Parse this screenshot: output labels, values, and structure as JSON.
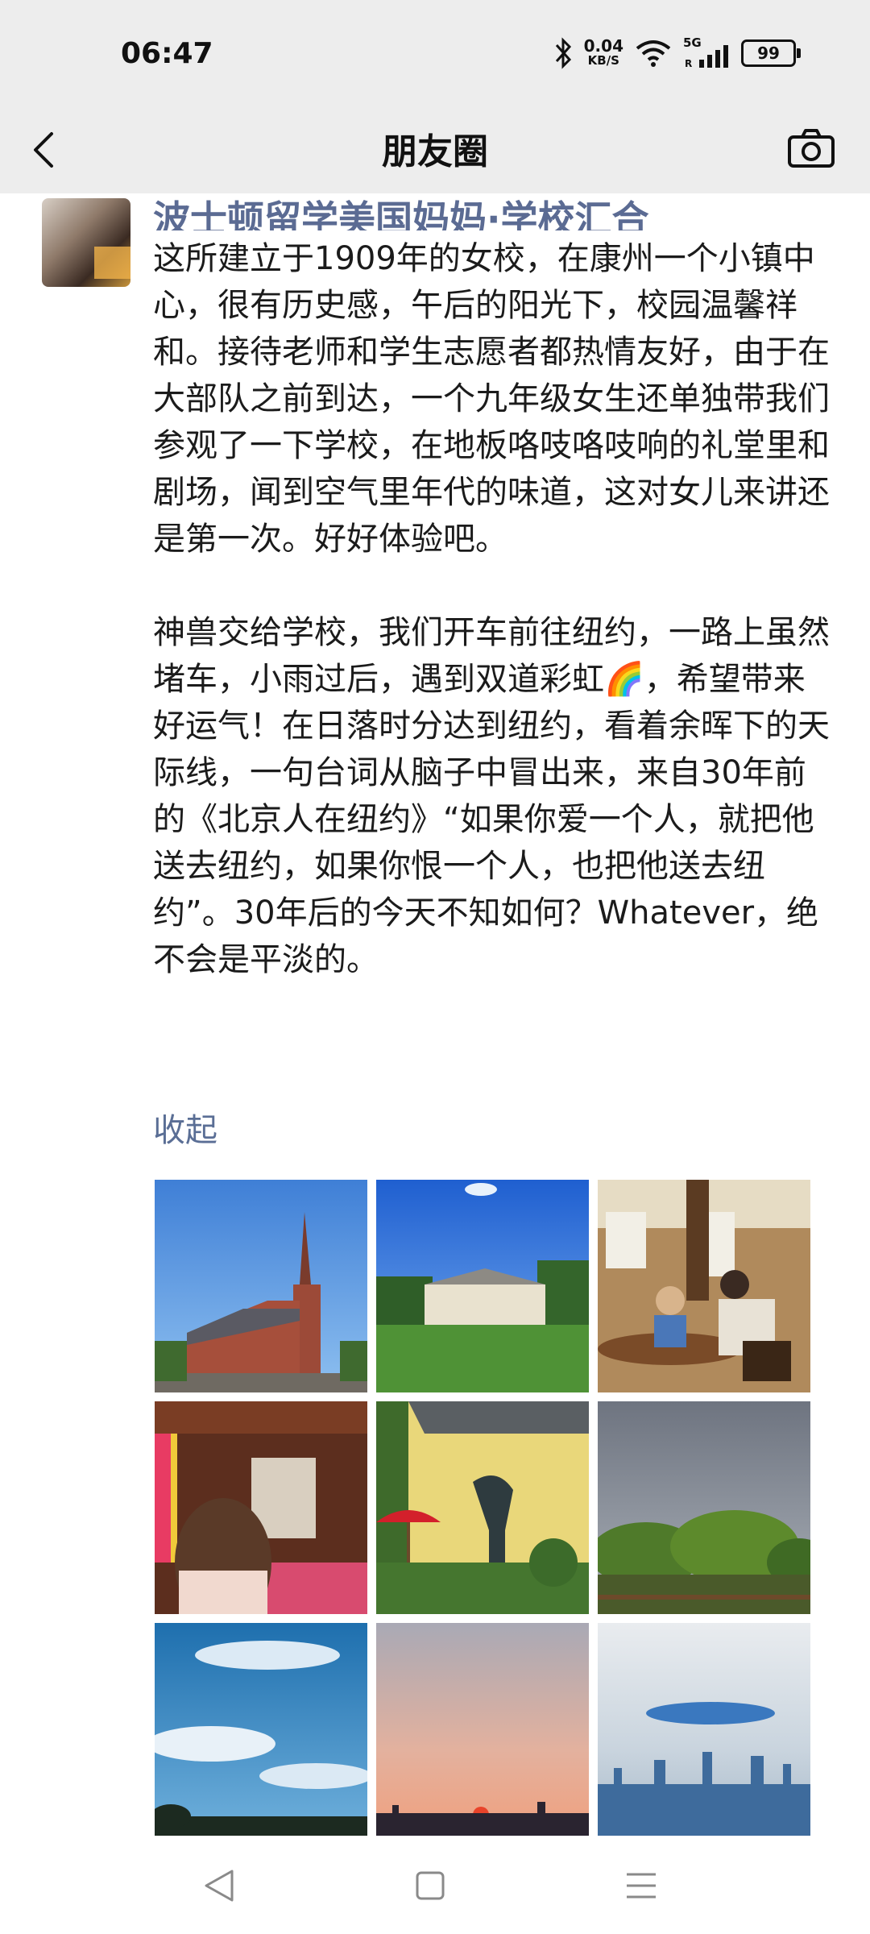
{
  "status_bar": {
    "time": "06:47",
    "net_speed_value": "0.04",
    "net_speed_unit": "KB/S",
    "network_type": "5G",
    "roaming": "R",
    "battery": "99",
    "icons": [
      "bluetooth-icon",
      "wifi-icon",
      "signal-icon",
      "battery-icon"
    ]
  },
  "nav": {
    "title": "朋友圈",
    "back_icon": "back-arrow-icon",
    "camera_icon": "camera-icon"
  },
  "post": {
    "author_name_partial": "波士顿留学美国妈妈·学校汇合",
    "text": "这所建立于1909年的女校，在康州一个小镇中心，很有历史感，午后的阳光下，校园温馨祥和。接待老师和学生志愿者都热情友好，由于在大部队之前到达，一个九年级女生还单独带我们参观了一下学校，在地板咯吱咯吱响的礼堂里和剧场，闻到空气里年代的味道，这对女儿来讲还是第一次。好好体验吧。\n\n神兽交给学校，我们开车前往纽约，一路上虽然堵车，小雨过后，遇到双道彩虹🌈，希望带来好运气！在日落时分达到纽约，看着余晖下的天际线，一句台词从脑子中冒出来，来自30年前的《北京人在纽约》“如果你爱一个人，就把他送去纽约，如果你恨一个人，也把他送去纽约”。30年后的今天不知如何？Whatever，绝不会是平淡的。",
    "collapse_label": "收起",
    "photos": [
      {
        "subject": "red-brick-church"
      },
      {
        "subject": "campus-lawn"
      },
      {
        "subject": "dining-hall"
      },
      {
        "subject": "chapel-interior"
      },
      {
        "subject": "garden-statue"
      },
      {
        "subject": "stormy-trees"
      },
      {
        "subject": "sky-clouds"
      },
      {
        "subject": "sunset"
      },
      {
        "subject": "city-skyline"
      }
    ]
  },
  "system_nav": {
    "icons": [
      "system-back-icon",
      "system-home-icon",
      "system-menu-icon"
    ]
  },
  "colors": {
    "header_bg": "#ededed",
    "link_blue": "#5a6e95",
    "text": "#1b1b1b"
  }
}
